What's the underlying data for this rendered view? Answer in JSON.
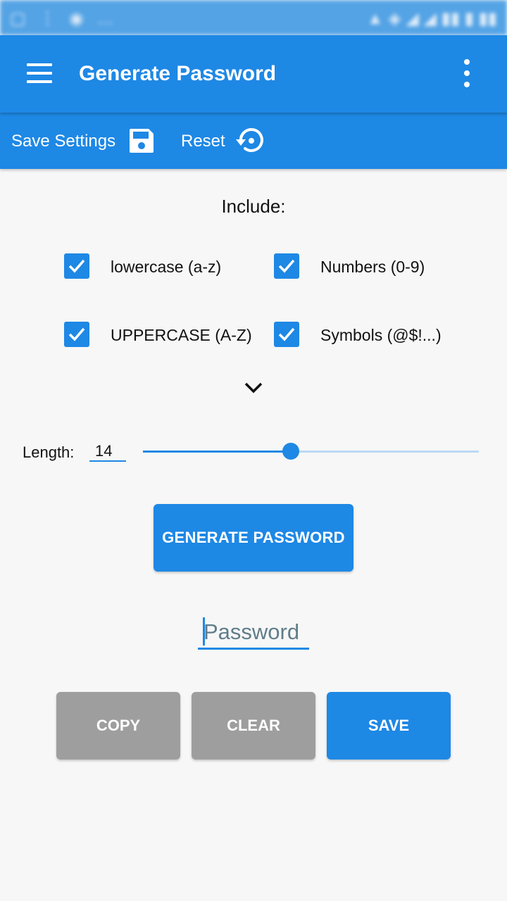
{
  "colors": {
    "primary": "#1e88e5",
    "secondary_button": "#9e9e9e",
    "background": "#f7f7f7"
  },
  "app_bar": {
    "title": "Generate Password",
    "menu_icon": "hamburger-menu-icon",
    "overflow_icon": "more-vert-icon"
  },
  "toolbar": {
    "save_settings_label": "Save Settings",
    "save_icon": "floppy-disk-icon",
    "reset_label": "Reset",
    "reset_icon": "restore-icon"
  },
  "include": {
    "title": "Include:",
    "options": [
      {
        "label": "lowercase (a-z)",
        "checked": true
      },
      {
        "label": "Numbers (0-9)",
        "checked": true
      },
      {
        "label": "UPPERCASE (A-Z)",
        "checked": true
      },
      {
        "label": "Symbols (@$!...)",
        "checked": true
      }
    ],
    "expand_icon": "chevron-down-icon"
  },
  "length": {
    "label": "Length:",
    "value": "14",
    "slider_fraction": 0.44
  },
  "generate_button": {
    "label": "GENERATE PASSWORD"
  },
  "password_field": {
    "placeholder": "Password",
    "value": ""
  },
  "actions": {
    "copy_label": "COPY",
    "clear_label": "CLEAR",
    "save_label": "SAVE"
  }
}
